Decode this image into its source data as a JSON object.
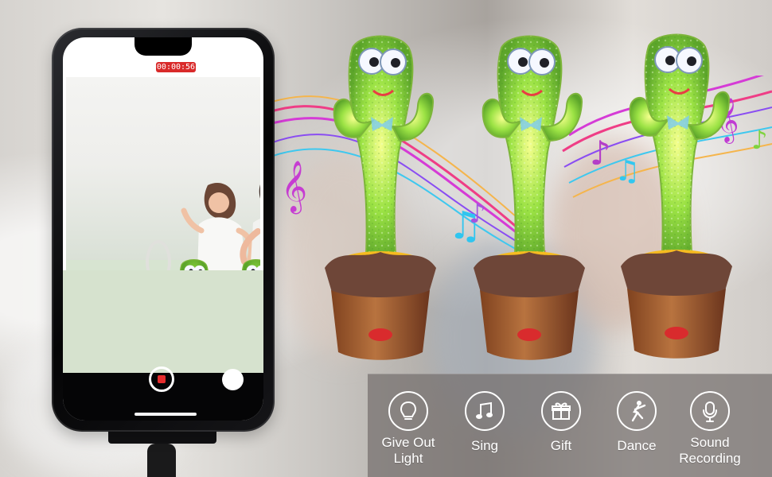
{
  "phone": {
    "recording_time": "00:00:56"
  },
  "features": [
    {
      "label": "Give Out Light",
      "icon": "lightbulb-icon"
    },
    {
      "label": "Sing",
      "icon": "music-note-icon"
    },
    {
      "label": "Gift",
      "icon": "gift-icon"
    },
    {
      "label": "Dance",
      "icon": "dancer-icon"
    },
    {
      "label": "Sound Recording",
      "icon": "microphone-icon"
    }
  ],
  "colors": {
    "recording_badge": "#d92a2a",
    "cactus_green": "#7ccf2c",
    "pot_brown": "#a75e32",
    "pot_rim": "#6e4638",
    "icon_panel": "#746f6d"
  }
}
